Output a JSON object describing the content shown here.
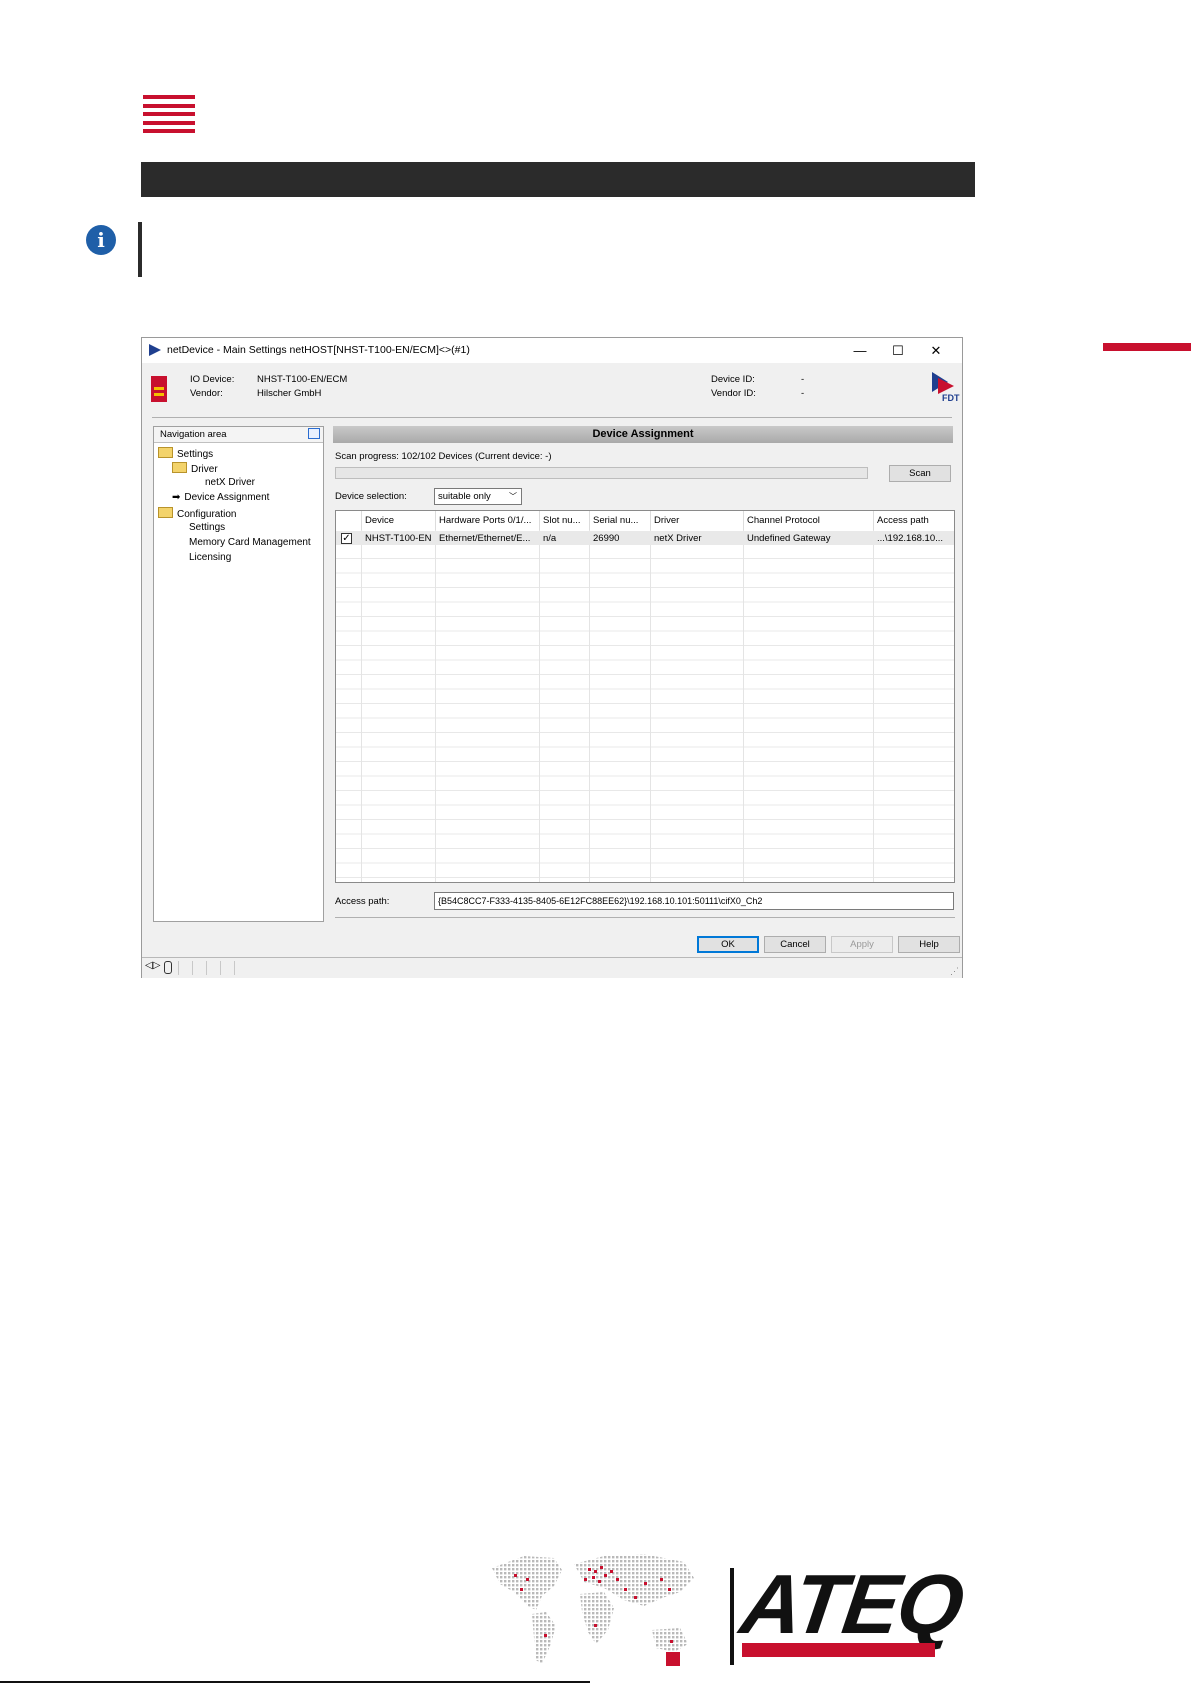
{
  "dialog": {
    "title": "netDevice - Main Settings netHOST[NHST-T100-EN/ECM]<>(#1)",
    "window_controls": {
      "minimize": "—",
      "maximize": "☐",
      "close": "✕"
    },
    "header": {
      "io_device_label": "IO Device:",
      "io_device_value": "NHST-T100-EN/ECM",
      "vendor_label": "Vendor:",
      "vendor_value": "Hilscher GmbH",
      "device_id_label": "Device ID:",
      "device_id_value": "-",
      "vendor_id_label": "Vendor ID:",
      "vendor_id_value": "-",
      "fdt_label": "FDT"
    },
    "navigation": {
      "title": "Navigation area",
      "items": [
        {
          "label": "Settings"
        },
        {
          "label": "Driver"
        },
        {
          "label": "netX Driver"
        },
        {
          "label": "Device Assignment"
        },
        {
          "label": "Configuration"
        },
        {
          "label": "Settings"
        },
        {
          "label": "Memory Card Management"
        },
        {
          "label": "Licensing"
        }
      ]
    },
    "section_title": "Device Assignment",
    "scan_progress": "Scan progress: 102/102 Devices (Current device: -)",
    "scan_progress_fraction": 0,
    "scan_button": "Scan",
    "device_selection_label": "Device selection:",
    "device_selection_value": "suitable only",
    "table": {
      "headers": [
        "",
        "Device",
        "Hardware Ports 0/1/...",
        "Slot nu...",
        "Serial nu...",
        "Driver",
        "Channel Protocol",
        "Access path"
      ],
      "rows": [
        {
          "checked": "✓",
          "device": "NHST-T100-EN",
          "hardware_ports": "Ethernet/Ethernet/E...",
          "slot": "n/a",
          "serial": "26990",
          "driver": "netX Driver",
          "protocol": "Undefined Gateway",
          "access_path": "...\\192.168.10..."
        }
      ]
    },
    "access_path_label": "Access path:",
    "access_path_value": "{B54C8CC7-F333-4135-8405-6E12FC88EE62}\\192.168.10.101:50111\\cifX0_Ch2",
    "buttons": {
      "ok": "OK",
      "cancel": "Cancel",
      "apply": "Apply",
      "help": "Help"
    }
  },
  "brand": {
    "logo_text": "ATEQ",
    "accent_color": "#c8102e",
    "dark_color": "#2b2b2b",
    "info_color": "#1f5fa8"
  }
}
